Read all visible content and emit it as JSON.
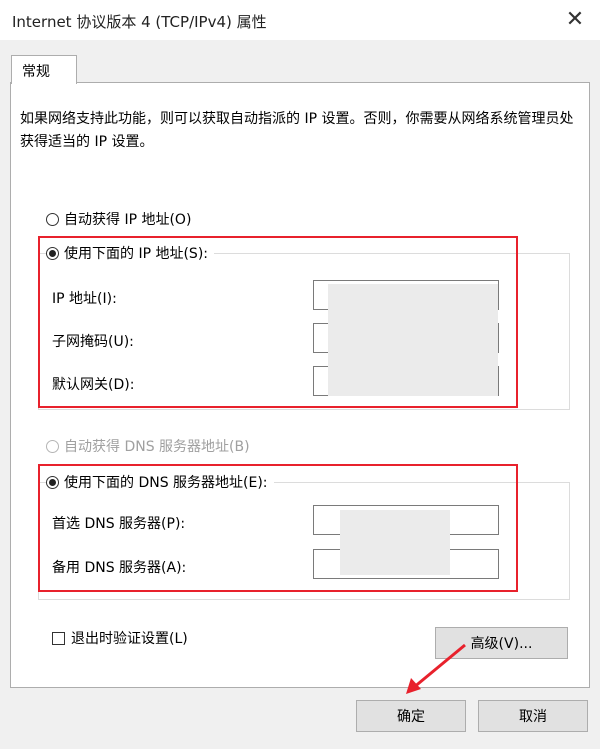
{
  "window": {
    "title": "Internet 协议版本 4 (TCP/IPv4) 属性"
  },
  "tabs": [
    {
      "label": "常规"
    }
  ],
  "description": "如果网络支持此功能，则可以获取自动指派的 IP 设置。否则，你需要从网络系统管理员处获得适当的 IP 设置。",
  "ip": {
    "auto_label": "自动获得 IP 地址(O)",
    "manual_label": "使用下面的 IP 地址(S):",
    "ip_address_label": "IP 地址(I):",
    "subnet_label": "子网掩码(U):",
    "gateway_label": "默认网关(D):",
    "ip_address_value": "",
    "subnet_value": "",
    "gateway_value": ""
  },
  "dns": {
    "auto_label": "自动获得 DNS 服务器地址(B)",
    "manual_label": "使用下面的 DNS 服务器地址(E):",
    "preferred_label": "首选 DNS 服务器(P):",
    "alternate_label": "备用 DNS 服务器(A):",
    "preferred_value": "",
    "alternate_value": ""
  },
  "validate_label": "退出时验证设置(L)",
  "buttons": {
    "advanced": "高级(V)...",
    "ok": "确定",
    "cancel": "取消"
  },
  "colors": {
    "highlight": "#e8212c"
  }
}
